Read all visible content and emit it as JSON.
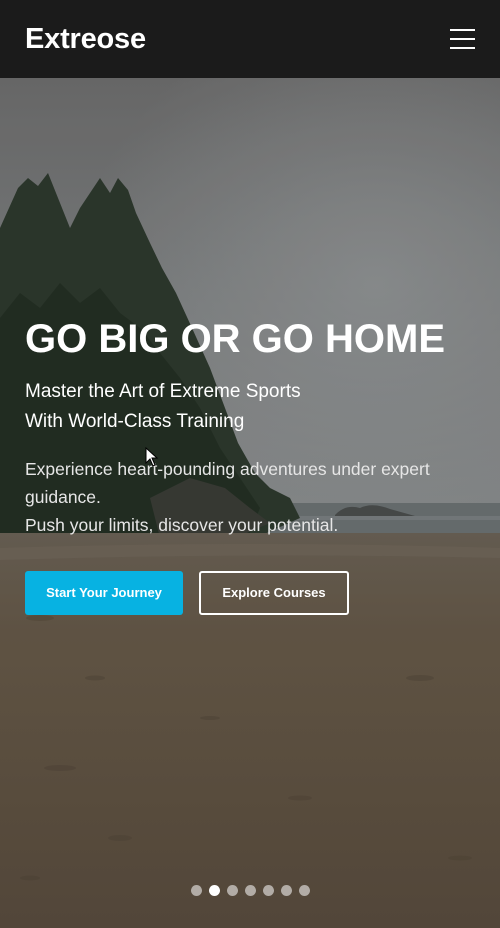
{
  "header": {
    "brand": "Extreose",
    "menu_icon": "hamburger-menu-icon"
  },
  "hero": {
    "headline": "GO BIG OR GO HOME",
    "subhead_line1": "Master the Art of Extreme Sports",
    "subhead_line2": "With World-Class Training",
    "desc_line1": "Experience heart-pounding adventures under expert",
    "desc_line2": "guidance.",
    "desc_line3": "Push your limits, discover your potential.",
    "primary_button": "Start Your Journey",
    "secondary_button": "Explore Courses",
    "slide_count": 7,
    "active_slide": 2,
    "colors": {
      "primary_button": "#07b2e2",
      "header_bg": "#1b1b1b"
    }
  }
}
